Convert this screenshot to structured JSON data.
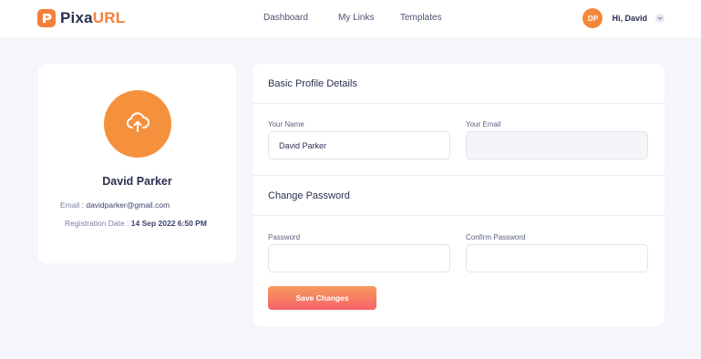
{
  "brand": {
    "name_part1": "Pixa",
    "name_part2": "URL",
    "accent": "#f57f3a"
  },
  "nav": {
    "links": [
      "Dashboard",
      "My Links",
      "Templates"
    ]
  },
  "user": {
    "initials": "DP",
    "greeting": "Hi, David"
  },
  "profile": {
    "name": "David Parker",
    "email_label": "Email : ",
    "email": "davidparker@gmail.com",
    "registration_label": "Registration Date : ",
    "registration_date": "14 Sep 2022 6:50 PM",
    "upload_icon": "cloud-upload-icon"
  },
  "basic": {
    "title": "Basic Profile Details",
    "name_label": "Your Name",
    "name_value": "David Parker",
    "email_label": "Your Email",
    "email_value": ""
  },
  "password": {
    "title": "Change Password",
    "password_label": "Password",
    "confirm_label": "Confirm Password"
  },
  "actions": {
    "save": "Save Changes"
  }
}
